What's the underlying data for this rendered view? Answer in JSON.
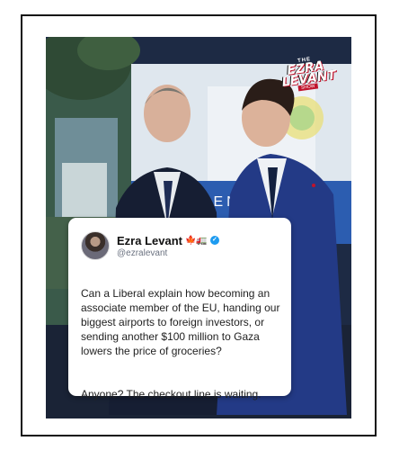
{
  "brand": {
    "logo_line1": "THE",
    "logo_line2": "EZRA",
    "logo_line3": "LEVANT",
    "logo_line4": "SHOW"
  },
  "tweet": {
    "author_name": "Ezra Levant",
    "author_emoji": "🍁🚛",
    "handle": "@ezralevant",
    "paragraph_1": "Can a Liberal explain how becoming an associate member of the EU, handing our biggest airports to foreign investors, or sending another $100 million to Gaza lowers the price of groceries?",
    "paragraph_2": "Anyone? The checkout line is waiting."
  },
  "background_text": "GEN",
  "colors": {
    "accent_red": "#c0132b",
    "verified_blue": "#1d9bf0",
    "suit_navy": "#1f2d55"
  }
}
